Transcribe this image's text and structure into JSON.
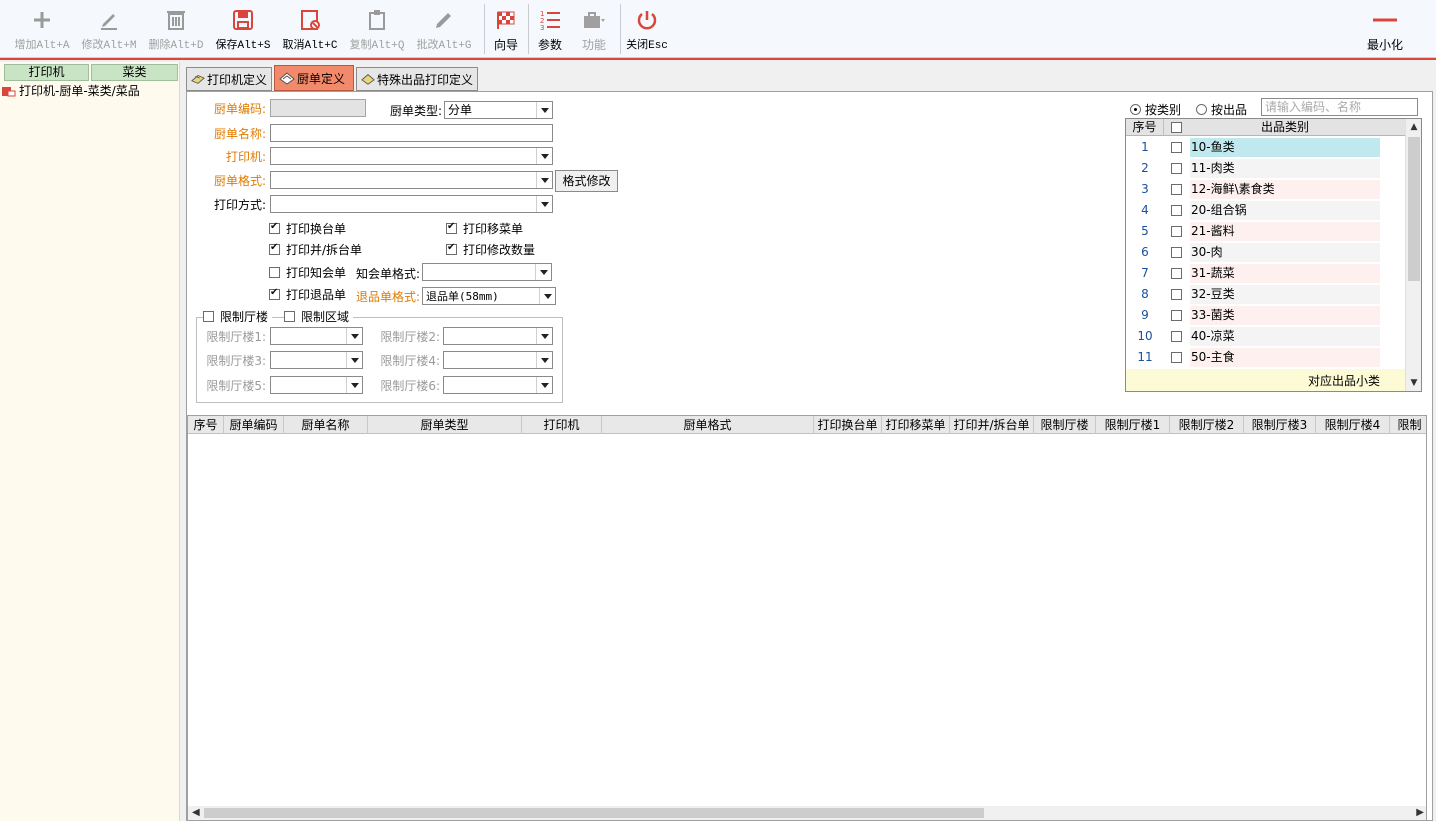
{
  "toolbar": {
    "add": "增加Alt+A",
    "edit": "修改Alt+M",
    "delete": "删除Alt+D",
    "save": "保存Alt+S",
    "cancel": "取消Alt+C",
    "copy": "复制Alt+Q",
    "batch_edit": "批改Alt+G",
    "wizard": "向导",
    "params": "参数",
    "function": "功能",
    "close": "关闭Esc",
    "minimize": "最小化"
  },
  "colors": {
    "accent_red": "#d9473c",
    "tab_active": "#f2896a",
    "required_label": "#e07b00"
  },
  "left": {
    "tab_printer": "打印机",
    "tab_category": "菜类",
    "tree_item": "打印机-厨单-菜类/菜品"
  },
  "tabs": {
    "printer_def": "打印机定义",
    "kitchen_def": "厨单定义",
    "special_def": "特殊出品打印定义"
  },
  "form": {
    "code_label": "厨单编码:",
    "type_label": "厨单类型:",
    "type_value": "分单",
    "name_label": "厨单名称:",
    "printer_label": "打印机:",
    "format_label": "厨单格式:",
    "format_edit_btn": "格式修改",
    "print_mode_label": "打印方式:",
    "cb_change_table": "打印换台单",
    "cb_move_dish": "打印移菜单",
    "cb_merge_split": "打印并/拆台单",
    "cb_modify_qty": "打印修改数量",
    "cb_notice": "打印知会单",
    "notice_format_label": "知会单格式:",
    "cb_return": "打印退品单",
    "return_format_label": "退品单格式:",
    "return_format_value": "退品单(58mm)",
    "limit_floor": "限制厅楼",
    "limit_area": "限制区域",
    "floor1": "限制厅楼1:",
    "floor2": "限制厅楼2:",
    "floor3": "限制厅楼3:",
    "floor4": "限制厅楼4:",
    "floor5": "限制厅楼5:",
    "floor6": "限制厅楼6:"
  },
  "filter": {
    "by_category": "按类别",
    "by_item": "按出品",
    "search_placeholder": "请输入编码、名称"
  },
  "category_grid": {
    "col_no": "序号",
    "col_category": "出品类别",
    "footer": "对应出品小类",
    "rows": [
      {
        "no": "1",
        "name": "10-鱼类"
      },
      {
        "no": "2",
        "name": "11-肉类"
      },
      {
        "no": "3",
        "name": "12-海鲜\\素食类"
      },
      {
        "no": "4",
        "name": "20-组合锅"
      },
      {
        "no": "5",
        "name": "21-酱料"
      },
      {
        "no": "6",
        "name": "30-肉"
      },
      {
        "no": "7",
        "name": "31-蔬菜"
      },
      {
        "no": "8",
        "name": "32-豆类"
      },
      {
        "no": "9",
        "name": "33-菌类"
      },
      {
        "no": "10",
        "name": "40-凉菜"
      },
      {
        "no": "11",
        "name": "50-主食"
      }
    ]
  },
  "bottom_grid": {
    "columns": [
      "序号",
      "厨单编码",
      "厨单名称",
      "厨单类型",
      "打印机",
      "厨单格式",
      "打印换台单",
      "打印移菜单",
      "打印并/拆台单",
      "限制厅楼",
      "限制厅楼1",
      "限制厅楼2",
      "限制厅楼3",
      "限制厅楼4",
      "限制"
    ]
  }
}
